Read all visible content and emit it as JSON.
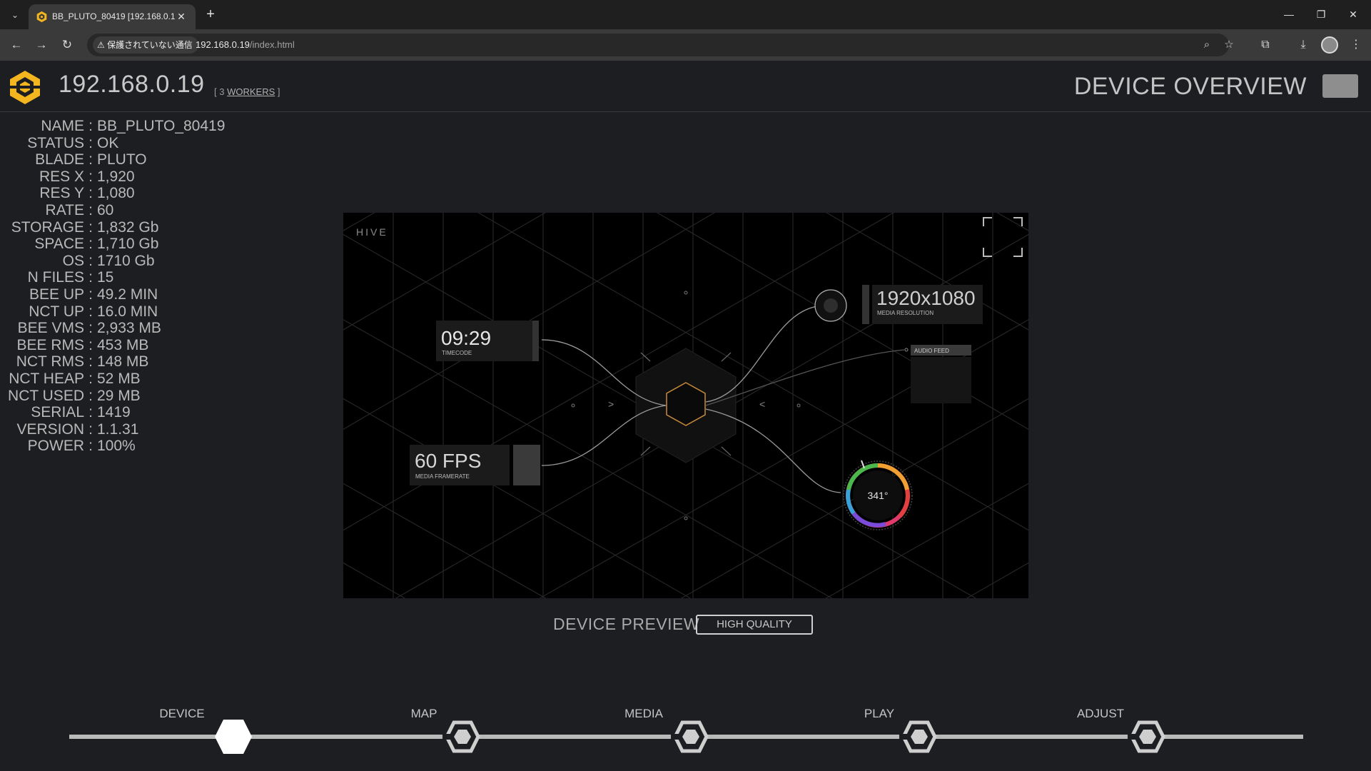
{
  "browser": {
    "tab_title": "BB_PLUTO_80419 [192.168.0.19",
    "security_label": "保護されていない通信",
    "url_host": "192.168.0.19",
    "url_path": "/index.html"
  },
  "header": {
    "ip": "192.168.0.19",
    "workers_open": "[ 3 ",
    "workers_link": "WORKERS",
    "workers_close": " ]",
    "title": "DEVICE OVERVIEW"
  },
  "info": [
    {
      "key": "NAME",
      "value": "BB_PLUTO_80419"
    },
    {
      "key": "STATUS",
      "value": "OK"
    },
    {
      "key": "BLADE",
      "value": "PLUTO"
    },
    {
      "key": "RES X",
      "value": "1,920"
    },
    {
      "key": "RES Y",
      "value": "1,080"
    },
    {
      "key": "RATE",
      "value": "60"
    },
    {
      "key": "STORAGE",
      "value": "1,832 Gb"
    },
    {
      "key": "SPACE",
      "value": "1,710 Gb"
    },
    {
      "key": "OS",
      "value": "1710 Gb"
    },
    {
      "key": "N FILES",
      "value": "15"
    },
    {
      "key": "BEE UP",
      "value": "49.2 MIN"
    },
    {
      "key": "NCT UP",
      "value": "16.0 MIN"
    },
    {
      "key": "BEE VMS",
      "value": "2,933 MB"
    },
    {
      "key": "BEE RMS",
      "value": "453 MB"
    },
    {
      "key": "NCT RMS",
      "value": "148 MB"
    },
    {
      "key": "NCT HEAP",
      "value": "52 MB"
    },
    {
      "key": "NCT USED",
      "value": "29 MB"
    },
    {
      "key": "SERIAL",
      "value": "1419"
    },
    {
      "key": "VERSION",
      "value": "1.1.31"
    },
    {
      "key": "POWER",
      "value": "100%"
    }
  ],
  "preview": {
    "brand": "HIVE",
    "timecode": "09:29",
    "timecode_label": "TIMECODE",
    "resolution": "1920x1080",
    "resolution_label": "MEDIA RESOLUTION",
    "audio_label": "AUDIO FEED",
    "fps": "60 FPS",
    "fps_label": "MEDIA FRAMERATE",
    "hue": "341°"
  },
  "preview_label": "DEVICE PREVIEW",
  "quality_button": "HIGH QUALITY",
  "steps": [
    "DEVICE",
    "MAP",
    "MEDIA",
    "PLAY",
    "ADJUST"
  ],
  "active_step": "DEVICE",
  "colors": {
    "accent": "#f3b61f",
    "background": "#1d1e21",
    "hex_outline": "#c78a3a"
  }
}
